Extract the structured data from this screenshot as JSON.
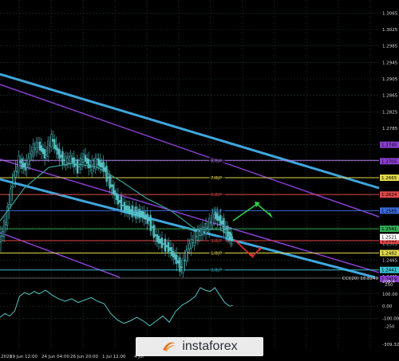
{
  "colors": {
    "background": "#000000",
    "grid": "#1d3a2c",
    "candle": "#56c4c8",
    "moving_average": "#3aa39a",
    "channel_cyan": "#3fa6dc",
    "channel_purple": "#8a3fd0",
    "cci_line": "#56c4c8"
  },
  "brand": {
    "name": "instaforex",
    "icon": "instaforex-swoosh-icon"
  },
  "chart_data": [
    {
      "type": "candlestick",
      "title": "",
      "x_ticks": [
        "13 Jun 2020",
        "19 Jun 12:00",
        "24 Jun 04:00",
        "26 Jun 20:00",
        "1 Jul 12:00",
        "4 Jul"
      ],
      "y_ticks": [
        "1.3065",
        "1.3025",
        "1.2985",
        "1.2945",
        "1.2905",
        "1.2865",
        "1.2825",
        "1.2785",
        "1.2745",
        "1.2705",
        "1.2665",
        "1.2625",
        "1.2585",
        "1.2545",
        "1.2505",
        "1.2465",
        "1.2425"
      ],
      "ylim": [
        1.2425,
        1.3085
      ],
      "grid": true,
      "price_series": [
        [
          0,
          1.251
        ],
        [
          8,
          1.256
        ],
        [
          16,
          1.2655
        ],
        [
          24,
          1.2705
        ],
        [
          32,
          1.269
        ],
        [
          40,
          1.273
        ],
        [
          48,
          1.2745
        ],
        [
          56,
          1.272
        ],
        [
          64,
          1.276
        ],
        [
          72,
          1.2725
        ],
        [
          80,
          1.2705
        ],
        [
          88,
          1.271
        ],
        [
          96,
          1.269
        ],
        [
          104,
          1.2715
        ],
        [
          112,
          1.269
        ],
        [
          120,
          1.2705
        ],
        [
          128,
          1.269
        ],
        [
          136,
          1.265
        ],
        [
          144,
          1.2615
        ],
        [
          152,
          1.2595
        ],
        [
          160,
          1.2585
        ],
        [
          168,
          1.258
        ],
        [
          176,
          1.2575
        ],
        [
          184,
          1.256
        ],
        [
          192,
          1.252
        ],
        [
          200,
          1.2505
        ],
        [
          208,
          1.2495
        ],
        [
          216,
          1.247
        ],
        [
          224,
          1.2445
        ],
        [
          232,
          1.2495
        ],
        [
          240,
          1.252
        ],
        [
          248,
          1.2535
        ],
        [
          256,
          1.2545
        ],
        [
          264,
          1.2575
        ],
        [
          272,
          1.256
        ],
        [
          280,
          1.253
        ],
        [
          286,
          1.2515
        ]
      ],
      "moving_average": [
        [
          0,
          1.256
        ],
        [
          30,
          1.264
        ],
        [
          60,
          1.269
        ],
        [
          90,
          1.27
        ],
        [
          120,
          1.269
        ],
        [
          150,
          1.2655
        ],
        [
          180,
          1.2615
        ],
        [
          210,
          1.2585
        ],
        [
          240,
          1.254
        ],
        [
          270,
          1.254
        ],
        [
          286,
          1.252
        ]
      ],
      "murrey_levels": [
        {
          "label": "8/8",
          "marker": "8/8|P",
          "price": "1.2707",
          "color": "#b57cf0"
        },
        {
          "label": "7/8",
          "marker": "7/8|P",
          "price": "1.2665",
          "color": "#e0d94a"
        },
        {
          "label": "6/8",
          "marker": "6/8|P",
          "price": "1.2624",
          "color": "#e04848"
        },
        {
          "label": "5/8",
          "marker": "5/8|P",
          "price": "1.2585",
          "color": "#3b6bd9"
        },
        {
          "label": "4/8",
          "marker": "4/8|P",
          "price": "1.2541",
          "color": "#2ea84e"
        },
        {
          "label": "3/8",
          "marker": "3/8|P",
          "price": "1.2512",
          "color": "#e04848"
        },
        {
          "label": "1/8",
          "marker": "1/8|P",
          "price": "1.2482",
          "color": "#e0d94a"
        },
        {
          "label": "0/8",
          "marker": "0/8|P",
          "price": "1.2441",
          "color": "#39c0d0"
        }
      ],
      "level_tags": [
        "1.2745",
        "1.2705",
        "1.2665",
        "1.2624",
        "1.2585",
        "1.2541",
        "1.2512",
        "1.2482",
        "1.2441",
        "1.2419"
      ],
      "current_price": "1.2521",
      "forecast_arrows": [
        {
          "color": "green",
          "direction": "up-then-down"
        },
        {
          "color": "red",
          "direction": "down-then-up"
        }
      ]
    },
    {
      "type": "line",
      "title": "",
      "indicator_label": "CCI(20) 10.8249",
      "y_ticks": [
        "208.4",
        "100.00",
        "0.00",
        "-100.00",
        "-309.3221"
      ],
      "y_axis_marks": [
        "250",
        "-250"
      ],
      "ylim": [
        -309.3221,
        208.4
      ],
      "grid": true,
      "series": [
        {
          "values": [
            [
              0,
              -90
            ],
            [
              6,
              -60
            ],
            [
              12,
              -80
            ],
            [
              18,
              -40
            ],
            [
              24,
              80
            ],
            [
              30,
              110
            ],
            [
              36,
              95
            ],
            [
              42,
              120
            ],
            [
              48,
              100
            ],
            [
              56,
              130
            ],
            [
              64,
              90
            ],
            [
              72,
              60
            ],
            [
              80,
              40
            ],
            [
              88,
              60
            ],
            [
              96,
              30
            ],
            [
              104,
              50
            ],
            [
              112,
              70
            ],
            [
              120,
              40
            ],
            [
              128,
              20
            ],
            [
              136,
              -60
            ],
            [
              144,
              -110
            ],
            [
              152,
              -140
            ],
            [
              160,
              -120
            ],
            [
              168,
              -90
            ],
            [
              176,
              -120
            ],
            [
              184,
              -160
            ],
            [
              192,
              -120
            ],
            [
              200,
              -80
            ],
            [
              208,
              -130
            ],
            [
              216,
              -40
            ],
            [
              224,
              10
            ],
            [
              232,
              40
            ],
            [
              240,
              80
            ],
            [
              246,
              150
            ],
            [
              252,
              130
            ],
            [
              258,
              120
            ],
            [
              264,
              150
            ],
            [
              270,
              90
            ],
            [
              276,
              30
            ],
            [
              282,
              0
            ],
            [
              286,
              5
            ]
          ]
        }
      ]
    }
  ]
}
